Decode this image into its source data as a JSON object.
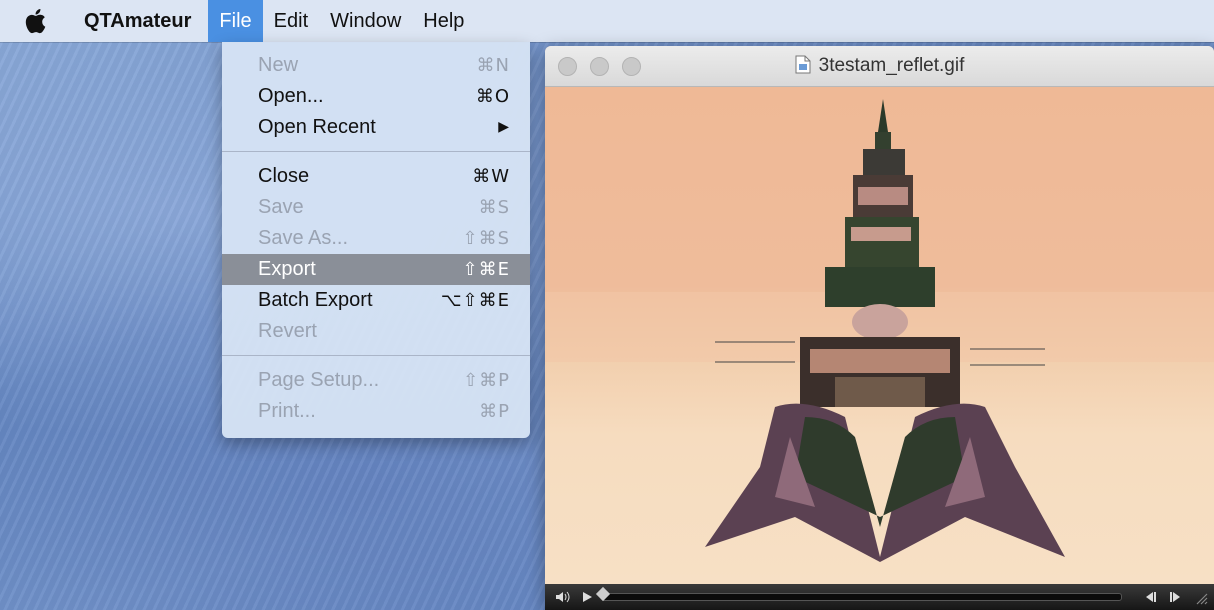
{
  "menubar": {
    "app_name": "QTAmateur",
    "menus": [
      "File",
      "Edit",
      "Window",
      "Help"
    ]
  },
  "file_menu": {
    "items": [
      {
        "label": "New",
        "shortcut": "⌘N",
        "enabled": false
      },
      {
        "label": "Open...",
        "shortcut": "⌘O",
        "enabled": true
      },
      {
        "label": "Open Recent",
        "shortcut": "▶",
        "enabled": true
      },
      {
        "label": "Close",
        "shortcut": "⌘W",
        "enabled": true
      },
      {
        "label": "Save",
        "shortcut": "⌘S",
        "enabled": false
      },
      {
        "label": "Save As...",
        "shortcut": "⇧⌘S",
        "enabled": false
      },
      {
        "label": "Export",
        "shortcut": "⇧⌘E",
        "enabled": true,
        "highlighted": true
      },
      {
        "label": "Batch Export",
        "shortcut": "⌥⇧⌘E",
        "enabled": true
      },
      {
        "label": "Revert",
        "shortcut": "",
        "enabled": false
      },
      {
        "label": "Page Setup...",
        "shortcut": "⇧⌘P",
        "enabled": false
      },
      {
        "label": "Print...",
        "shortcut": "⌘P",
        "enabled": false
      }
    ]
  },
  "window": {
    "title": "3testam_reflet.gif",
    "playback_position": 0
  },
  "colors": {
    "menu_active": "#4a90e2",
    "menu_highlight": "#8a8f98",
    "canvas_top": "#efb996",
    "canvas_bottom": "#f7e0c5"
  },
  "icons": [
    "apple-logo-icon",
    "document-icon",
    "volume-icon",
    "play-icon",
    "step-back-icon",
    "step-forward-icon",
    "resize-grip-icon"
  ]
}
